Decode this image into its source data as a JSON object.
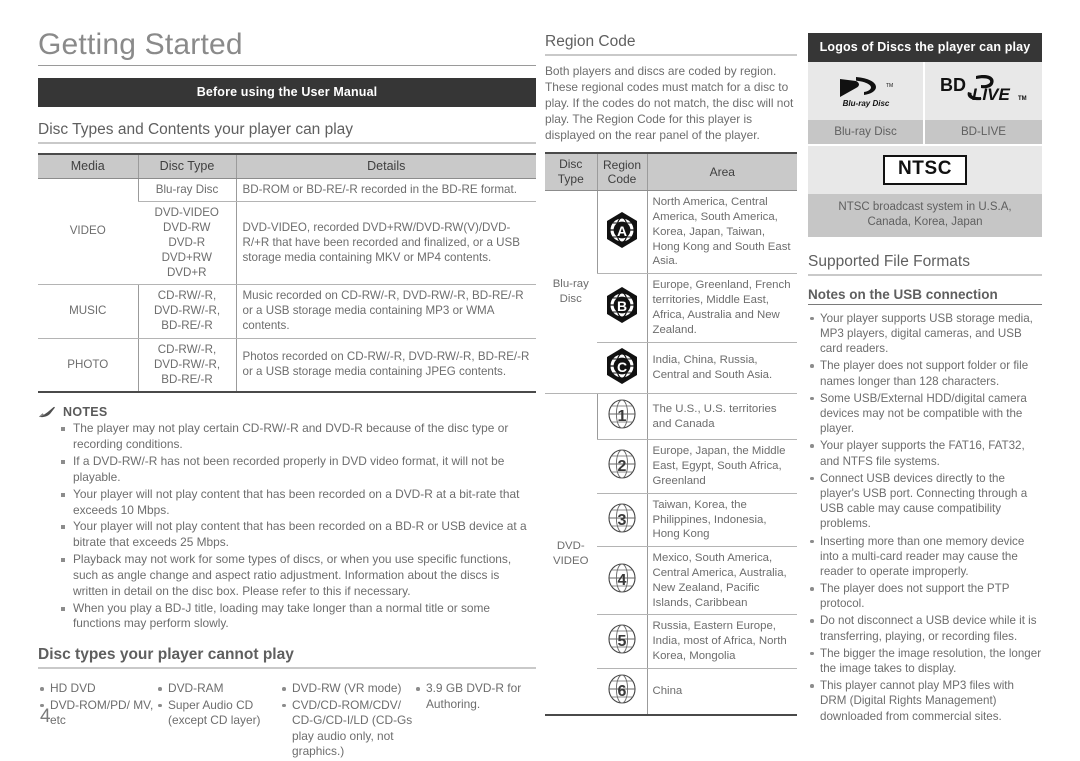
{
  "page": {
    "title": "Getting Started",
    "number": "4",
    "banner": "Before using the User Manual"
  },
  "disc_section": {
    "heading": "Disc Types and Contents your player can play",
    "table": {
      "headers": [
        "Media",
        "Disc Type",
        "Details"
      ],
      "rows": [
        {
          "media": "",
          "disc_type": "Blu-ray Disc",
          "details": "BD-ROM or BD-RE/-R recorded in the BD-RE format."
        },
        {
          "media": "VIDEO",
          "disc_type": "DVD-VIDEO\nDVD-RW\nDVD-R\nDVD+RW\nDVD+R",
          "details": "DVD-VIDEO, recorded DVD+RW/DVD-RW(V)/DVD-R/+R that have been recorded and finalized, or a USB storage media containing MKV or MP4 contents."
        },
        {
          "media": "MUSIC",
          "disc_type": "CD-RW/-R,\nDVD-RW/-R,\nBD-RE/-R",
          "details": "Music recorded on CD-RW/-R, DVD-RW/-R, BD-RE/-R or a USB storage media containing MP3 or WMA contents."
        },
        {
          "media": "PHOTO",
          "disc_type": "CD-RW/-R,\nDVD-RW/-R,\nBD-RE/-R",
          "details": "Photos recorded on CD-RW/-R, DVD-RW/-R, BD-RE/-R or a USB storage media containing JPEG contents."
        }
      ]
    }
  },
  "notes": {
    "label": "NOTES",
    "items": [
      "The player may not play certain CD-RW/-R and DVD-R because of the disc type or recording conditions.",
      "If a DVD-RW/-R has not been recorded properly in DVD video format, it will not be playable.",
      "Your player will not play content that has been recorded on a DVD-R at a bit-rate that exceeds 10 Mbps.",
      "Your player will not play content that has been recorded on a BD-R or USB device at a bitrate that exceeds 25 Mbps.",
      "Playback may not work for some types of discs, or when you use specific functions, such as angle change and aspect ratio adjustment. Information about the discs is written in detail on the disc box. Please refer to this if necessary.",
      "When you play a BD-J title, loading may take longer than a normal title or some functions may perform slowly."
    ]
  },
  "cannot_play": {
    "heading": "Disc types your player cannot play",
    "columns": [
      [
        "HD DVD",
        "DVD-ROM/PD/ MV, etc"
      ],
      [
        "DVD-RAM",
        "Super Audio CD (except CD layer)"
      ],
      [
        "DVD-RW (VR mode)",
        "CVD/CD-ROM/CDV/ CD-G/CD-I/LD (CD-Gs play audio only, not graphics.)"
      ],
      [
        "3.9 GB DVD-R for Authoring."
      ]
    ]
  },
  "region_code": {
    "heading": "Region Code",
    "paragraph": "Both players and discs are coded by region. These regional codes must match for a disc to play. If the codes do not match, the disc will not play. The Region Code for this player is displayed on the rear panel of the player.",
    "table": {
      "headers": [
        "Disc Type",
        "Region Code",
        "Area"
      ],
      "groups": [
        {
          "disc_type": "Blu-ray Disc",
          "rows": [
            {
              "code": "A",
              "shape": "hex",
              "area": "North America, Central America, South America, Korea, Japan, Taiwan, Hong Kong and South East Asia."
            },
            {
              "code": "B",
              "shape": "hex",
              "area": "Europe, Greenland, French territories, Middle East, Africa, Australia and New Zealand."
            },
            {
              "code": "C",
              "shape": "hex",
              "area": "India, China, Russia, Central and South Asia."
            }
          ]
        },
        {
          "disc_type": "DVD-VIDEO",
          "rows": [
            {
              "code": "1",
              "shape": "circle",
              "area": "The U.S., U.S. territories and Canada"
            },
            {
              "code": "2",
              "shape": "circle",
              "area": "Europe, Japan, the Middle East, Egypt, South Africa, Greenland"
            },
            {
              "code": "3",
              "shape": "circle",
              "area": "Taiwan, Korea, the Philippines, Indonesia, Hong Kong"
            },
            {
              "code": "4",
              "shape": "circle",
              "area": "Mexico, South America, Central America, Australia, New Zealand, Pacific Islands, Caribbean"
            },
            {
              "code": "5",
              "shape": "circle",
              "area": "Russia, Eastern Europe, India, most of Africa, North Korea, Mongolia"
            },
            {
              "code": "6",
              "shape": "circle",
              "area": "China"
            }
          ]
        }
      ]
    }
  },
  "logos": {
    "banner": "Logos of Discs the player can play",
    "items": [
      {
        "icon": "blu-ray-disc-logo",
        "label": "Blu-ray Disc"
      },
      {
        "icon": "bd-live-logo",
        "label": "BD-LIVE"
      }
    ],
    "ntsc": {
      "badge": "NTSC",
      "caption": "NTSC broadcast system in U.S.A, Canada, Korea, Japan"
    }
  },
  "file_formats": {
    "heading": "Supported File Formats",
    "subheading": "Notes on the USB connection",
    "items": [
      "Your player supports USB storage media, MP3 players, digital cameras, and USB card readers.",
      "The player does not support folder or file names longer than 128 characters.",
      "Some USB/External HDD/digital camera devices may not be compatible with the player.",
      "Your player supports the FAT16, FAT32, and NTFS file systems.",
      "Connect USB devices directly to the player's USB port. Connecting through a USB cable may cause compatibility problems.",
      "Inserting more than one memory device into a multi-card reader may cause the reader to operate improperly.",
      "The player does not support the PTP protocol.",
      "Do not disconnect a USB device while it is transferring, playing, or recording files.",
      "The bigger the image resolution, the longer the image takes to display.",
      "This player cannot play MP3 files with DRM (Digital Rights Management) downloaded from commercial sites."
    ]
  }
}
